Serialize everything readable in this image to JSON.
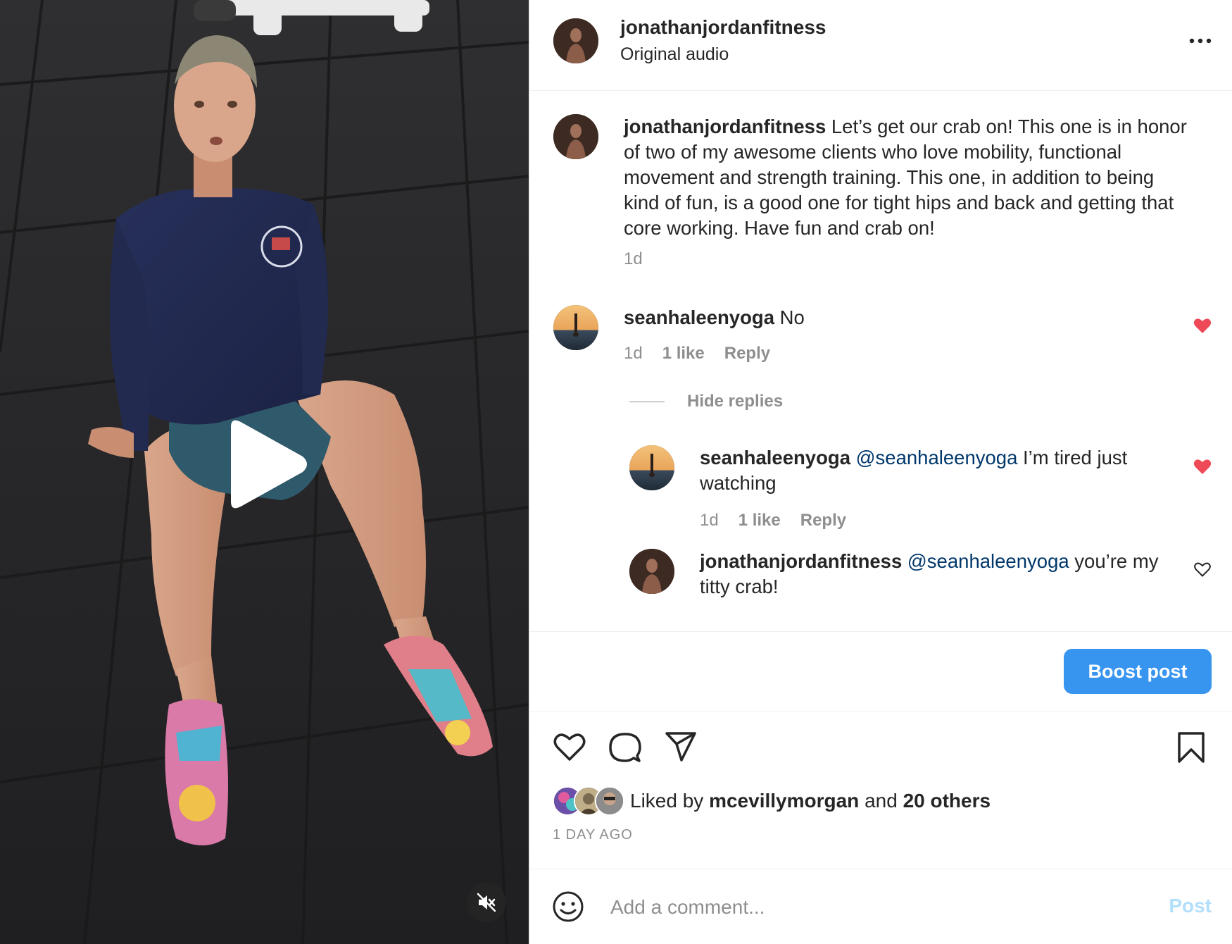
{
  "post": {
    "username": "jonathanjordanfitness",
    "audio": "Original audio",
    "more_icon": "more-options-icon"
  },
  "caption": {
    "username": "jonathanjordanfitness",
    "text": "Let’s get our crab on! This one is in honor of two of my awesome clients who love mobility, functional movement and strength training. This one, in addition to being kind of fun, is a good one for tight hips and back and getting that core working. Have fun and crab on!",
    "time": "1d"
  },
  "comments": [
    {
      "username": "seanhaleenyoga",
      "text": "No",
      "time": "1d",
      "likes": "1 like",
      "reply_label": "Reply",
      "liked": true,
      "hide_replies_label": "Hide replies",
      "replies": [
        {
          "username": "seanhaleenyoga",
          "mention": "@seanhaleenyoga",
          "text": "I’m tired just watching",
          "time": "1d",
          "likes": "1 like",
          "reply_label": "Reply",
          "liked": true
        },
        {
          "username": "jonathanjordanfitness",
          "mention": "@seanhaleenyoga",
          "text": "you’re my titty crab!",
          "liked": false
        }
      ]
    }
  ],
  "boost": {
    "label": "Boost post"
  },
  "actions": {
    "icons": [
      "heart-icon",
      "comment-icon",
      "share-icon",
      "bookmark-icon"
    ]
  },
  "likes": {
    "prefix": "Liked by",
    "user": "mcevillymorgan",
    "middle": "and",
    "others": "20 others"
  },
  "date": "1 DAY AGO",
  "add_comment": {
    "placeholder": "Add a comment...",
    "post_label": "Post"
  },
  "colors": {
    "accent": "#3795f0",
    "liked_heart": "#ed4956",
    "muted_text": "#8e8e8e",
    "mention": "#00376b",
    "post_disabled": "#b2dffc"
  }
}
